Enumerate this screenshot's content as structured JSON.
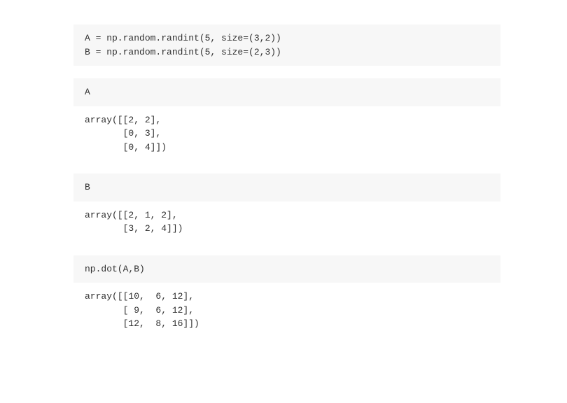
{
  "cells": [
    {
      "type": "input",
      "text": "A = np.random.randint(5, size=(3,2))\nB = np.random.randint(5, size=(2,3))"
    },
    {
      "type": "input",
      "text": "A"
    },
    {
      "type": "output",
      "text": "array([[2, 2],\n       [0, 3],\n       [0, 4]])"
    },
    {
      "type": "input",
      "text": "B"
    },
    {
      "type": "output",
      "text": "array([[2, 1, 2],\n       [3, 2, 4]])"
    },
    {
      "type": "input",
      "text": "np.dot(A,B)"
    },
    {
      "type": "output",
      "text": "array([[10,  6, 12],\n       [ 9,  6, 12],\n       [12,  8, 16]])"
    }
  ]
}
